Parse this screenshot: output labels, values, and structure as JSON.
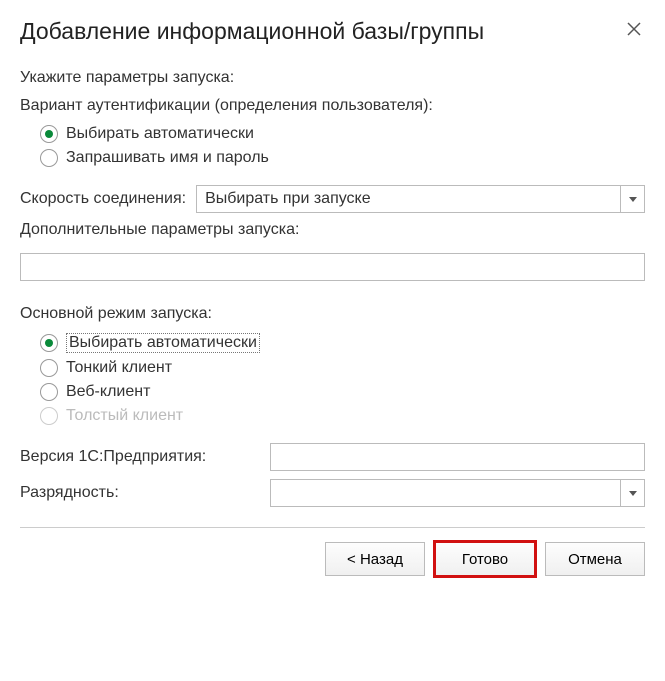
{
  "dialog": {
    "title": "Добавление информационной базы/группы",
    "prompt": "Укажите параметры запуска:"
  },
  "auth": {
    "label": "Вариант аутентификации (определения пользователя):",
    "options": {
      "auto": "Выбирать автоматически",
      "manual": "Запрашивать имя и пароль"
    },
    "selected": "auto"
  },
  "connection_speed": {
    "label": "Скорость соединения:",
    "value": "Выбирать при запуске"
  },
  "extra_params": {
    "label": "Дополнительные параметры запуска:",
    "value": ""
  },
  "launch_mode": {
    "label": "Основной режим запуска:",
    "options": {
      "auto": "Выбирать автоматически",
      "thin": "Тонкий клиент",
      "web": "Веб-клиент",
      "thick": "Толстый клиент"
    },
    "selected": "auto",
    "disabled": [
      "thick"
    ]
  },
  "version": {
    "label": "Версия 1С:Предприятия:",
    "value": ""
  },
  "bitness": {
    "label": "Разрядность:",
    "value": ""
  },
  "buttons": {
    "back": "< Назад",
    "finish": "Готово",
    "cancel": "Отмена"
  }
}
